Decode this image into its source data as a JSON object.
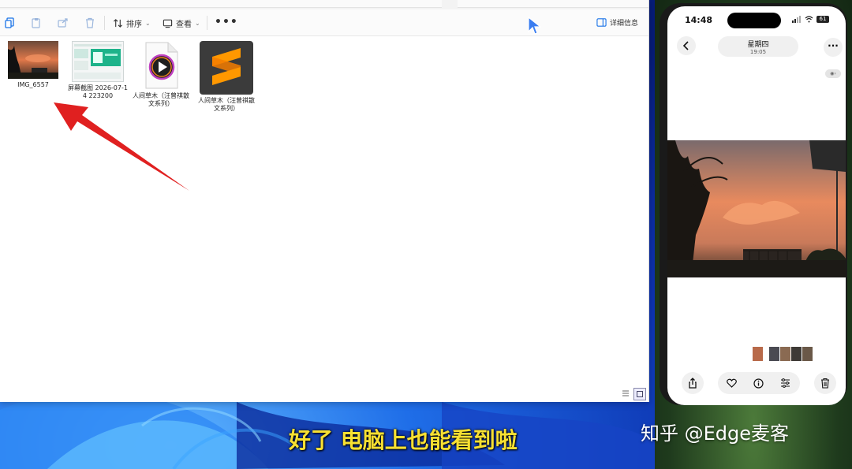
{
  "explorer": {
    "toolbar": {
      "sort_label": "排序",
      "view_label": "查看",
      "more_label": "•••",
      "details_label": "详细信息"
    },
    "files": [
      {
        "name": "IMG_6557",
        "type": "photo"
      },
      {
        "name": "屏幕截图 2026-07-14 223200",
        "type": "screenshot"
      },
      {
        "name": "人间草木（汪曾祺散文系列）",
        "type": "audio"
      },
      {
        "name": "人间草木（汪曾祺散文系列）",
        "type": "sublime-document"
      }
    ]
  },
  "phone": {
    "status_time": "14:48",
    "battery": "61",
    "nav_day": "星期四",
    "nav_time": "19:05"
  },
  "subtitle": "好了 电脑上也能看到啦",
  "watermark": "知乎 @Edge麦客",
  "colors": {
    "accent": "#1a73e8",
    "arrow": "#e02020",
    "subtitle": "#f7e032"
  }
}
